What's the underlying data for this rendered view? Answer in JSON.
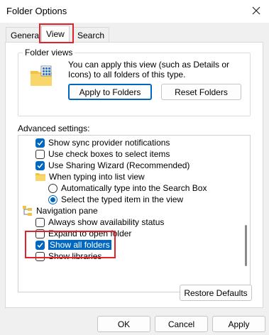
{
  "window": {
    "title": "Folder Options"
  },
  "tabs": {
    "general": "General",
    "view": "View",
    "search": "Search"
  },
  "folder_views": {
    "legend": "Folder views",
    "description": "You can apply this view (such as Details or Icons) to all folders of this type.",
    "apply_label": "Apply to Folders",
    "reset_label": "Reset Folders"
  },
  "advanced": {
    "label": "Advanced settings:",
    "items": [
      {
        "type": "checkbox",
        "checked": true,
        "label": "Show sync provider notifications"
      },
      {
        "type": "checkbox",
        "checked": false,
        "label": "Use check boxes to select items"
      },
      {
        "type": "checkbox",
        "checked": true,
        "label": "Use Sharing Wizard (Recommended)"
      },
      {
        "type": "folder",
        "label": "When typing into list view"
      },
      {
        "type": "radio",
        "checked": false,
        "label": "Automatically type into the Search Box"
      },
      {
        "type": "radio",
        "checked": true,
        "label": "Select the typed item in the view"
      },
      {
        "type": "nav",
        "label": "Navigation pane"
      },
      {
        "type": "checkbox",
        "checked": false,
        "label": "Always show availability status"
      },
      {
        "type": "checkbox",
        "checked": false,
        "label": "Expand to open folder"
      },
      {
        "type": "checkbox",
        "checked": true,
        "label": "Show all folders"
      },
      {
        "type": "checkbox",
        "checked": false,
        "label": "Show libraries"
      }
    ]
  },
  "buttons": {
    "restore": "Restore Defaults",
    "ok": "OK",
    "cancel": "Cancel",
    "apply": "Apply"
  },
  "colors": {
    "accent": "#0067c0",
    "highlight": "#e0232b"
  },
  "icons": [
    "close-icon",
    "folder-grid-icon",
    "folder-icon",
    "navigation-pane-icon"
  ]
}
